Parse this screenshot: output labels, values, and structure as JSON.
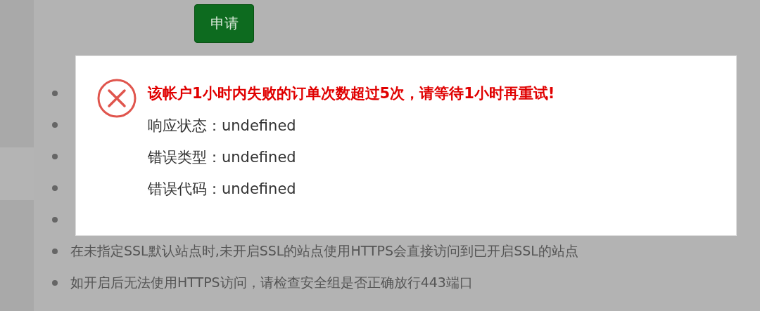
{
  "apply_button": {
    "label": "申请"
  },
  "list_items": [
    {
      "text": "在未指定SSL默认站点时,未开启SSL的站点使用HTTPS会直接访问到已开启SSL的站点"
    },
    {
      "text": "如开启后无法使用HTTPS访问，请检查安全组是否正确放行443端口"
    }
  ],
  "dialog": {
    "kind": "error",
    "message": "该帐户1小时内失败的订单次数超过5次，请等待1小时再重试!",
    "fields": [
      {
        "label": "响应状态：",
        "value": "undefined"
      },
      {
        "label": "错误类型：",
        "value": "undefined"
      },
      {
        "label": "错误代码：",
        "value": "undefined"
      }
    ]
  }
}
